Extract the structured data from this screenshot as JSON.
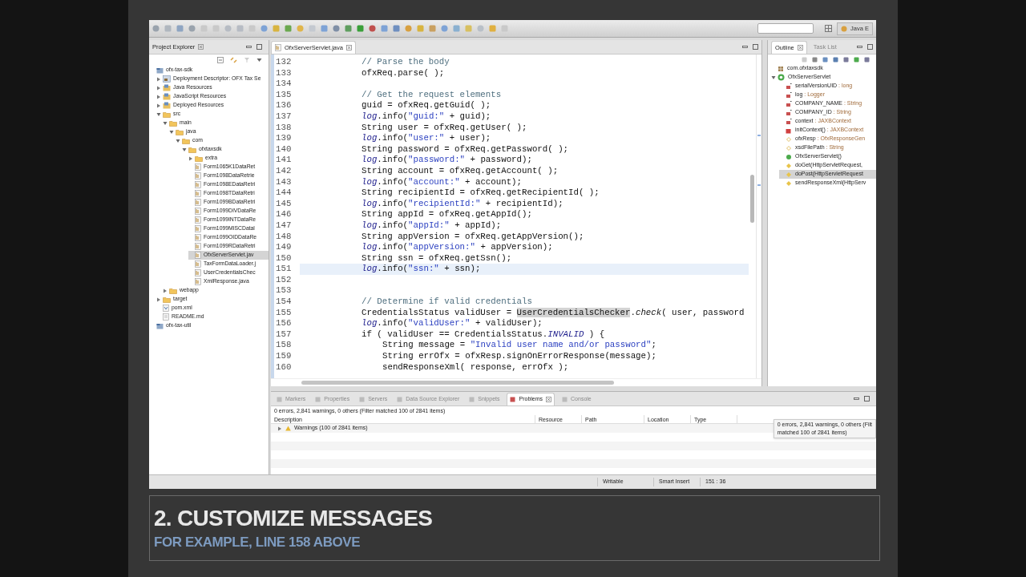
{
  "toolbar": {
    "perspective": "Java E"
  },
  "project_explorer": {
    "title": "Project Explorer",
    "tree": [
      {
        "label": "ofx-tax-sdk",
        "kind": "project",
        "selected": false,
        "children": [
          {
            "label": "Deployment Descriptor: OFX Tax Se",
            "kind": "descriptor",
            "expanded": false,
            "selected": false
          },
          {
            "label": "Java Resources",
            "kind": "resources",
            "expanded": false,
            "selected": false
          },
          {
            "label": "JavaScript Resources",
            "kind": "resources",
            "expanded": false,
            "selected": false
          },
          {
            "label": "Deployed Resources",
            "kind": "resources",
            "expanded": false,
            "selected": false
          },
          {
            "label": "src",
            "kind": "folder",
            "expanded": true,
            "selected": false,
            "children": [
              {
                "label": "main",
                "kind": "folder",
                "expanded": true,
                "selected": false,
                "children": [
                  {
                    "label": "java",
                    "kind": "folder",
                    "expanded": true,
                    "selected": false,
                    "children": [
                      {
                        "label": "com",
                        "kind": "folder",
                        "expanded": true,
                        "selected": false,
                        "children": [
                          {
                            "label": "ofxtaxsdk",
                            "kind": "folder",
                            "expanded": true,
                            "selected": false,
                            "children": [
                              {
                                "label": "extra",
                                "kind": "folder",
                                "expanded": false,
                                "selected": false
                              },
                              {
                                "label": "Form1065K1DataRet",
                                "kind": "java",
                                "selected": false
                              },
                              {
                                "label": "Form1098DataRetrie",
                                "kind": "java",
                                "selected": false
                              },
                              {
                                "label": "Form1098EDataRetri",
                                "kind": "java",
                                "selected": false
                              },
                              {
                                "label": "Form1098TDataRetri",
                                "kind": "java",
                                "selected": false
                              },
                              {
                                "label": "Form1099BDataRetri",
                                "kind": "java",
                                "selected": false
                              },
                              {
                                "label": "Form1099DIVDataRe",
                                "kind": "java",
                                "selected": false
                              },
                              {
                                "label": "Form1099INTDataRe",
                                "kind": "java",
                                "selected": false
                              },
                              {
                                "label": "Form1099MISCDatal",
                                "kind": "java",
                                "selected": false
                              },
                              {
                                "label": "Form1099OIDDataRe",
                                "kind": "java",
                                "selected": false
                              },
                              {
                                "label": "Form1099RDataRetri",
                                "kind": "java",
                                "selected": false
                              },
                              {
                                "label": "OfxServerServlet.jav",
                                "kind": "java",
                                "selected": true
                              },
                              {
                                "label": "TaxFormDataLoader.j",
                                "kind": "java",
                                "selected": false
                              },
                              {
                                "label": "UserCredentialsChec",
                                "kind": "java",
                                "selected": false
                              },
                              {
                                "label": "XmlResponse.java",
                                "kind": "java",
                                "selected": false
                              }
                            ]
                          }
                        ]
                      }
                    ]
                  }
                ]
              },
              {
                "label": "webapp",
                "kind": "folder",
                "expanded": false,
                "selected": false
              }
            ]
          },
          {
            "label": "target",
            "kind": "folder",
            "expanded": false,
            "selected": false
          },
          {
            "label": "pom.xml",
            "kind": "xml",
            "selected": false
          },
          {
            "label": "README.md",
            "kind": "file",
            "selected": false
          }
        ]
      },
      {
        "label": "ofx-tax-util",
        "kind": "project",
        "selected": false
      }
    ]
  },
  "editor": {
    "tab": "OfxServerServlet.java",
    "lines": [
      {
        "number": "132",
        "current": false,
        "tokens": [
          {
            "text": "// Parse the body",
            "kind": "comment"
          }
        ]
      },
      {
        "number": "133",
        "current": false,
        "tokens": [
          {
            "text": "ofxReq.parse( );",
            "kind": "plain"
          }
        ]
      },
      {
        "number": "134",
        "current": false
      },
      {
        "number": "135",
        "current": false,
        "tokens": [
          {
            "text": "// Get the request elements",
            "kind": "comment"
          }
        ]
      },
      {
        "number": "136",
        "current": false,
        "tokens": [
          {
            "text": "guid = ofxReq.getGuid( );",
            "kind": "plain"
          }
        ]
      },
      {
        "number": "137",
        "current": false,
        "tokens": [
          {
            "text": "log",
            "kind": "static"
          },
          {
            "text": ".info(",
            "kind": "plain"
          },
          {
            "text": "\"guid:\"",
            "kind": "string"
          },
          {
            "text": " + guid);",
            "kind": "plain"
          }
        ]
      },
      {
        "number": "138",
        "current": false,
        "tokens": [
          {
            "text": "String user = ofxReq.getUser( );",
            "kind": "plain"
          }
        ]
      },
      {
        "number": "139",
        "current": false,
        "tokens": [
          {
            "text": "log",
            "kind": "static"
          },
          {
            "text": ".info(",
            "kind": "plain"
          },
          {
            "text": "\"user:\"",
            "kind": "string"
          },
          {
            "text": " + user);",
            "kind": "plain"
          }
        ]
      },
      {
        "number": "140",
        "current": false,
        "tokens": [
          {
            "text": "String password = ofxReq.getPassword( );",
            "kind": "plain"
          }
        ]
      },
      {
        "number": "141",
        "current": false,
        "tokens": [
          {
            "text": "log",
            "kind": "static"
          },
          {
            "text": ".info(",
            "kind": "plain"
          },
          {
            "text": "\"password:\"",
            "kind": "string"
          },
          {
            "text": " + password);",
            "kind": "plain"
          }
        ]
      },
      {
        "number": "142",
        "current": false,
        "tokens": [
          {
            "text": "String account = ofxReq.getAccount( );",
            "kind": "plain"
          }
        ]
      },
      {
        "number": "143",
        "current": false,
        "tokens": [
          {
            "text": "log",
            "kind": "static"
          },
          {
            "text": ".info(",
            "kind": "plain"
          },
          {
            "text": "\"account:\"",
            "kind": "string"
          },
          {
            "text": " + account);",
            "kind": "plain"
          }
        ]
      },
      {
        "number": "144",
        "current": false,
        "tokens": [
          {
            "text": "String recipientId = ofxReq.getRecipientId( );",
            "kind": "plain"
          }
        ]
      },
      {
        "number": "145",
        "current": false,
        "tokens": [
          {
            "text": "log",
            "kind": "static"
          },
          {
            "text": ".info(",
            "kind": "plain"
          },
          {
            "text": "\"recipientId:\"",
            "kind": "string"
          },
          {
            "text": " + recipientId);",
            "kind": "plain"
          }
        ]
      },
      {
        "number": "146",
        "current": false,
        "tokens": [
          {
            "text": "String appId = ofxReq.getAppId();",
            "kind": "plain"
          }
        ]
      },
      {
        "number": "147",
        "current": false,
        "tokens": [
          {
            "text": "log",
            "kind": "static"
          },
          {
            "text": ".info(",
            "kind": "plain"
          },
          {
            "text": "\"appId:\"",
            "kind": "string"
          },
          {
            "text": " + appId);",
            "kind": "plain"
          }
        ]
      },
      {
        "number": "148",
        "current": false,
        "tokens": [
          {
            "text": "String appVersion = ofxReq.getAppVersion();",
            "kind": "plain"
          }
        ]
      },
      {
        "number": "149",
        "current": false,
        "tokens": [
          {
            "text": "log",
            "kind": "static"
          },
          {
            "text": ".info(",
            "kind": "plain"
          },
          {
            "text": "\"appVersion:\"",
            "kind": "string"
          },
          {
            "text": " + appVersion);",
            "kind": "plain"
          }
        ]
      },
      {
        "number": "150",
        "current": false,
        "tokens": [
          {
            "text": "String ssn = ofxReq.getSsn();",
            "kind": "plain"
          }
        ]
      },
      {
        "number": "151",
        "current": true,
        "tokens": [
          {
            "text": "log",
            "kind": "static"
          },
          {
            "text": ".info(",
            "kind": "plain"
          },
          {
            "text": "\"ssn:\"",
            "kind": "string"
          },
          {
            "text": " + ssn);",
            "kind": "plain"
          }
        ]
      },
      {
        "number": "152",
        "current": false
      },
      {
        "number": "153",
        "current": false
      },
      {
        "number": "154",
        "current": false,
        "tokens": [
          {
            "text": "// Determine if valid credentials",
            "kind": "comment"
          }
        ]
      },
      {
        "number": "155",
        "current": false,
        "tokens": [
          {
            "text": "CredentialsStatus validUser = ",
            "kind": "plain"
          },
          {
            "text": "UserCredentialsChecker",
            "kind": "highlight"
          },
          {
            "text": ".",
            "kind": "plain"
          },
          {
            "text": "check",
            "kind": "italic"
          },
          {
            "text": "( user, password",
            "kind": "plain"
          }
        ]
      },
      {
        "number": "156",
        "current": false,
        "tokens": [
          {
            "text": "log",
            "kind": "static"
          },
          {
            "text": ".info(",
            "kind": "plain"
          },
          {
            "text": "\"validUser:\"",
            "kind": "string"
          },
          {
            "text": " + validUser);",
            "kind": "plain"
          }
        ]
      },
      {
        "number": "157",
        "current": false,
        "tokens": [
          {
            "text": "if ( validUser == CredentialsStatus.",
            "kind": "plain"
          },
          {
            "text": "INVALID",
            "kind": "static"
          },
          {
            "text": " ) {",
            "kind": "plain"
          }
        ],
        "children": [
          {
            "number": "158",
            "current": false,
            "tokens": [
              {
                "text": "String message = ",
                "kind": "plain"
              },
              {
                "text": "\"Invalid user name and/or password\"",
                "kind": "string"
              },
              {
                "text": ";",
                "kind": "plain"
              }
            ]
          },
          {
            "number": "159",
            "current": false,
            "tokens": [
              {
                "text": "String errOfx = ofxResp.signOnErrorResponse(message);",
                "kind": "plain"
              }
            ]
          },
          {
            "number": "160",
            "current": false,
            "tokens": [
              {
                "text": "sendResponseXml( response, errOfx );",
                "kind": "plain"
              }
            ]
          }
        ]
      }
    ]
  },
  "outline": {
    "tabs": [
      {
        "label": "Outline",
        "selected": true
      },
      {
        "label": "Task List",
        "selected": false
      }
    ],
    "tree": [
      {
        "name": "com.ofxtaxsdk",
        "kind": "package",
        "selected": false
      },
      {
        "name": "OfxServerServlet",
        "kind": "class",
        "expanded": true,
        "selected": false,
        "children": [
          {
            "name": "serialVersionUID",
            "type": " : long",
            "kind": "private-field",
            "selected": false
          },
          {
            "name": "log",
            "type": " : Logger",
            "kind": "private-field",
            "selected": false
          },
          {
            "name": "COMPANY_NAME",
            "type": " : String",
            "kind": "private-field",
            "selected": false
          },
          {
            "name": "COMPANY_ID",
            "type": " : String",
            "kind": "private-field",
            "selected": false
          },
          {
            "name": "context",
            "type": " : JAXBContext",
            "kind": "private-field",
            "selected": false
          },
          {
            "name": "initContext()",
            "type": " : JAXBContext",
            "kind": "private-method",
            "selected": false
          },
          {
            "name": "ofxResp",
            "type": " : OfxResponseGen",
            "kind": "field",
            "selected": false
          },
          {
            "name": "xsdFilePath",
            "type": " : String",
            "kind": "field",
            "selected": false
          },
          {
            "name": "OfxServerServlet()",
            "kind": "constructor",
            "selected": false
          },
          {
            "name": "doGet(HttpServletRequest,",
            "kind": "method",
            "selected": false
          },
          {
            "name": "doPost(HttpServletRequest",
            "kind": "method",
            "selected": true
          },
          {
            "name": "sendResponseXml(HttpServ",
            "kind": "method",
            "selected": false
          }
        ]
      }
    ]
  },
  "bottom_panel": {
    "tabs": [
      {
        "label": "Markers",
        "selected": false
      },
      {
        "label": "Properties",
        "selected": false
      },
      {
        "label": "Servers",
        "selected": false
      },
      {
        "label": "Data Source Explorer",
        "selected": false
      },
      {
        "label": "Snippets",
        "selected": false
      },
      {
        "label": "Problems",
        "selected": true
      },
      {
        "label": "Console",
        "selected": false
      }
    ],
    "summary": "0 errors, 2,841 warnings, 0 others (Filter matched 100 of 2841 items)",
    "columns": [
      "Description",
      "Resource",
      "Path",
      "Location",
      "Type"
    ],
    "rows": [
      {
        "label": "Warnings (100 of 2841 items)",
        "expanded": false
      }
    ],
    "tooltip": [
      "0 errors, 2,841 warnings, 0 others (Filt",
      "matched 100 of 2841 items)"
    ]
  },
  "status_bar": [
    "Writable",
    "Smart Insert",
    "151 : 36"
  ],
  "caption": {
    "title": "2. CUSTOMIZE MESSAGES",
    "subtitle": "FOR EXAMPLE, LINE 158 ABOVE"
  }
}
